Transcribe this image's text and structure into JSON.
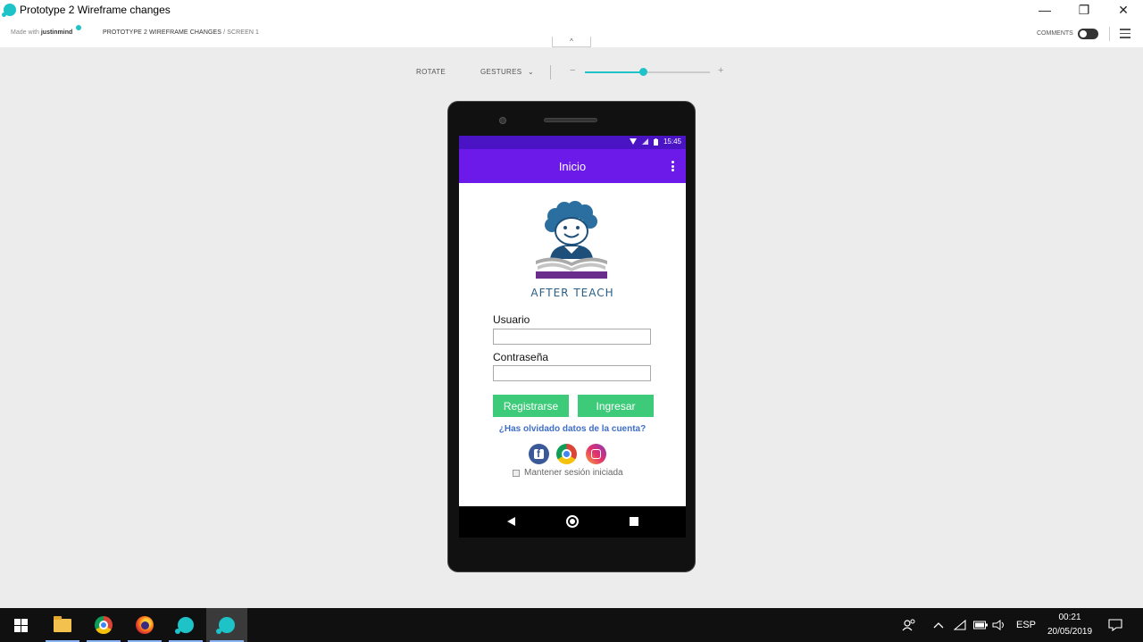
{
  "window": {
    "title": "Prototype 2 Wireframe changes",
    "minimize_glyph": "—",
    "restore_glyph": "❐",
    "close_glyph": "✕"
  },
  "toolbar": {
    "made_with_prefix": "Made with",
    "made_with_brand": "justinmind",
    "breadcrumb_project": "PROTOTYPE 2 WIREFRAME CHANGES",
    "breadcrumb_screen": "/ SCREEN 1",
    "collapse_glyph": "^",
    "comments_label": "COMMENTS"
  },
  "controls": {
    "rotate_label": "ROTATE",
    "gestures_label": "GESTURES",
    "gestures_chevron": "⌄",
    "zoom_minus": "−",
    "zoom_plus": "+",
    "zoom_level": 0.47
  },
  "device": {
    "status": {
      "time": "15:45",
      "icons": [
        "wifi-icon",
        "signal-icon",
        "battery-icon"
      ]
    },
    "appbar": {
      "title": "Inicio"
    },
    "logo_text": "AFTER TEACH",
    "form": {
      "username_label": "Usuario",
      "username_value": "",
      "password_label": "Contraseña",
      "password_value": "",
      "register_button": "Registrarse",
      "login_button": "Ingresar",
      "forgot_link": "¿Has olvidado datos de la cuenta?",
      "keep_session_label": "Mantener sesión iniciada",
      "keep_session_checked": false
    },
    "social": [
      "facebook-icon",
      "chrome-icon",
      "instagram-icon"
    ]
  },
  "taskbar": {
    "apps": [
      "windows-start",
      "file-explorer",
      "chrome",
      "firefox",
      "justinmind",
      "justinmind-active"
    ],
    "tray": {
      "language": "ESP",
      "time": "00:21",
      "date": "20/05/2019"
    }
  },
  "colors": {
    "accent": "#1ec3c8",
    "statusbar": "#4a14c5",
    "appbar": "#6b1aea",
    "button": "#3dcb7a",
    "link": "#3f6ec7"
  }
}
